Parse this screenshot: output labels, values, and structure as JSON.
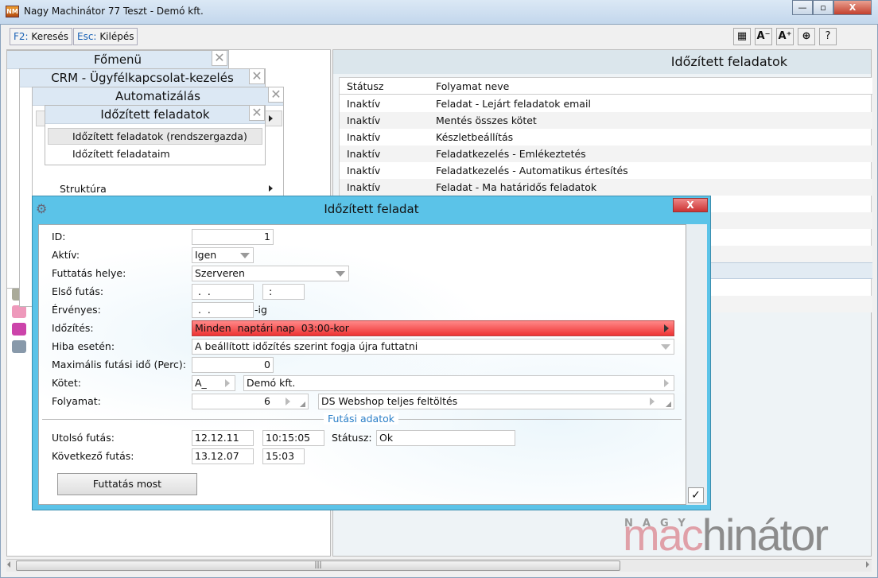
{
  "window": {
    "title": "Nagy Machinátor 77 Teszt - Demó kft.",
    "minimize": "—",
    "maximize": "▫",
    "close": "X"
  },
  "toolbar": {
    "search_key": "F2:",
    "search_label": "Keresés",
    "exit_key": "Esc:",
    "exit_label": "Kilépés",
    "tiles": "▦",
    "font_smaller": "A⁻",
    "font_larger": "A⁺",
    "support": "⊕",
    "help": "?"
  },
  "menus": {
    "main": {
      "title": "Főmenü"
    },
    "crm": {
      "title": "CRM - Ügyfélkapcsolat-kezelés"
    },
    "automation": {
      "title": "Automatizálás",
      "items": [
        "Struktúra"
      ]
    },
    "scheduled": {
      "title": "Időzített feladatok",
      "items": [
        "Időzített feladatok (rendszergazda)",
        "Időzített feladataim"
      ]
    },
    "close": "✕"
  },
  "list": {
    "title": "Időzített feladatok",
    "columns": [
      "Státusz",
      "Folyamat neve"
    ],
    "rows": [
      [
        "Inaktív",
        "Feladat - Lejárt feladatok email"
      ],
      [
        "Inaktív",
        "Mentés összes kötet"
      ],
      [
        "Inaktív",
        "Készletbeállítás"
      ],
      [
        "Inaktív",
        "Feladatkezelés - Emlékeztetés"
      ],
      [
        "Inaktív",
        "Feladatkezelés - Automatikus értesítés"
      ],
      [
        "Inaktív",
        "Feladat - Ma határidős feladatok"
      ]
    ]
  },
  "dialog": {
    "title": "Időzített feladat",
    "close": "X",
    "labels": {
      "id": "ID:",
      "active": "Aktív:",
      "location": "Futtatás helye:",
      "first_run": "Első futás:",
      "valid": "Érvényes:",
      "schedule": "Időzítés:",
      "on_error": "Hiba esetén:",
      "max_time": "Maximális futási idő (Perc):",
      "volume": "Kötet:",
      "process": "Folyamat:",
      "run_section": "Futási adatok",
      "last_run": "Utolsó futás:",
      "status": "Státusz:",
      "next_run": "Következő futás:",
      "valid_suffix": "-ig"
    },
    "values": {
      "id": "1",
      "active": "Igen",
      "location": "Szerveren",
      "first_run_date": " .  .",
      "first_run_time": " :",
      "valid_date": " .  .",
      "schedule": "Minden  naptári nap  03:00-kor",
      "on_error": "A beállított időzítés szerint fogja újra futtatni",
      "max_time": "0",
      "volume_code": "A_",
      "volume_name": "Demó kft.",
      "process_id": "6",
      "process_name": "DS Webshop teljes feltöltés",
      "last_run_date": "12.12.11",
      "last_run_time": "10:15:05",
      "status": "Ok",
      "next_run_date": "13.12.07",
      "next_run_time": "15:03"
    },
    "run_now": "Futtatás most",
    "ok": "✓"
  },
  "logo": {
    "top": "NAGY",
    "part1": "mac",
    "part2": "hinátor"
  },
  "colors": {
    "dialog_title": "#5bc3e8",
    "schedule_bg": "#f05050",
    "logo_red": "#e0a0a8",
    "logo_gray": "#8c8c8c"
  }
}
